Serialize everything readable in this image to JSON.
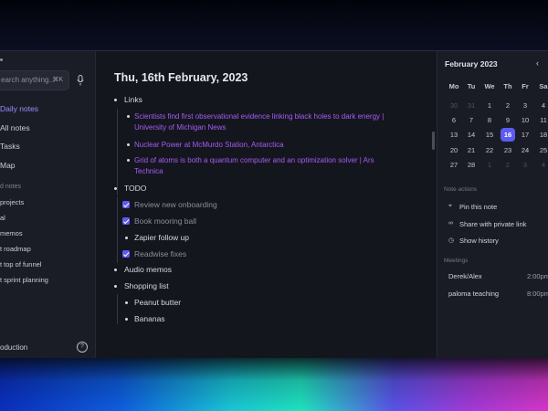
{
  "sidebar": {
    "search": {
      "placeholder": "earch anything...",
      "shortcut": "⌘K"
    },
    "nav": [
      {
        "label": "Daily notes",
        "active": true
      },
      {
        "label": "All notes",
        "active": false
      },
      {
        "label": "Tasks",
        "active": false
      },
      {
        "label": "Map",
        "active": false
      }
    ],
    "section_label": "d notes",
    "pages": [
      "projects",
      "al",
      "memos",
      "t roadmap",
      "t top of funnel",
      "t sprint planning"
    ],
    "footer": "oduction",
    "help_icon": "help-circle-icon",
    "mic_icon": "microphone-icon"
  },
  "main": {
    "title": "Thu, 16th February, 2023",
    "links_label": "Links",
    "links": [
      {
        "line1": "Scientists find first observational evidence linking black holes to dark energy |",
        "line2": "University of Michigan News"
      },
      {
        "line1": "Nuclear Power at McMurdo Station, Antarctica",
        "line2": ""
      },
      {
        "line1": "Grid of atoms is both a quantum computer and an optimization solver | Ars",
        "line2": "Technica"
      }
    ],
    "todo_label": "TODO",
    "todos": [
      {
        "label": "Review new onboarding",
        "checked": true
      },
      {
        "label": "Book mooring ball",
        "checked": true
      },
      {
        "label": "Zapier follow up",
        "checked": false
      },
      {
        "label": "Readwise fixes",
        "checked": true
      }
    ],
    "audio_label": "Audio memos",
    "shopping_label": "Shopping list",
    "shopping": [
      "Peanut butter",
      "Bananas"
    ],
    "link_color": "#a45cf2",
    "accent": "#5b5cf0"
  },
  "calendar": {
    "month": "February 2023",
    "prev_icon": "chevron-left-icon",
    "weekdays": [
      "Mo",
      "Tu",
      "We",
      "Th",
      "Fr",
      "Sa"
    ],
    "weeks": [
      [
        "30",
        "31",
        "1",
        "2",
        "3",
        "4"
      ],
      [
        "6",
        "7",
        "8",
        "9",
        "10",
        "11"
      ],
      [
        "13",
        "14",
        "15",
        "16",
        "17",
        "18"
      ],
      [
        "20",
        "21",
        "22",
        "23",
        "24",
        "25"
      ],
      [
        "27",
        "28",
        "1",
        "2",
        "3",
        "4"
      ]
    ],
    "selected": "16",
    "accent": "#5b5cf0"
  },
  "note_actions": {
    "label": "Note actions",
    "items": [
      {
        "label": "Pin this note",
        "icon": "pin-icon"
      },
      {
        "label": "Share with private link",
        "icon": "link-icon"
      },
      {
        "label": "Show history",
        "icon": "history-icon"
      }
    ]
  },
  "meetings": {
    "label": "Meetings",
    "items": [
      {
        "name": "Derek/Alex",
        "time": "2:00pm"
      },
      {
        "name": "paloma teaching",
        "time": "8:00pm"
      }
    ]
  }
}
